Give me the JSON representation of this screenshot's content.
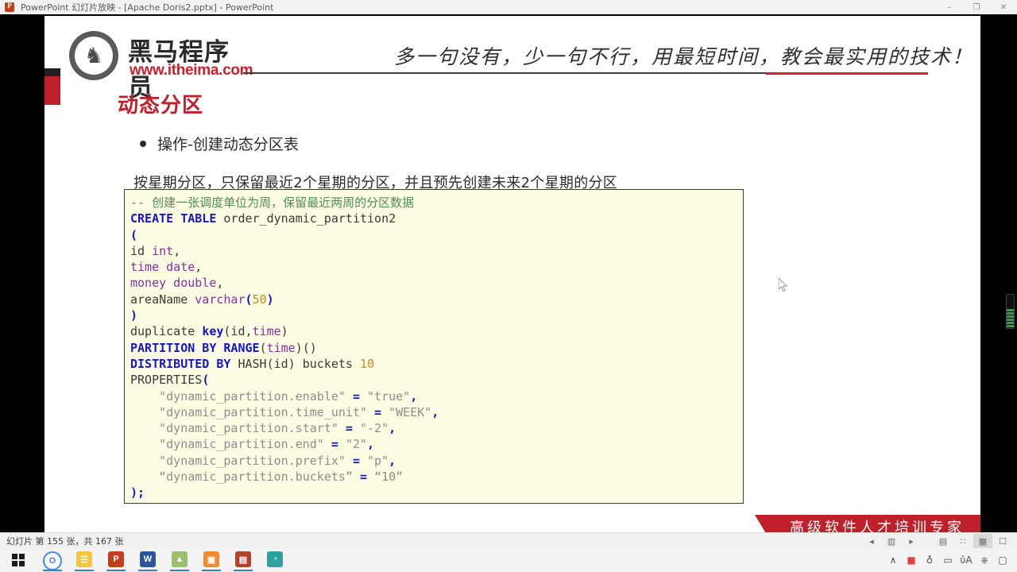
{
  "window": {
    "title": "PowerPoint 幻灯片放映 - [Apache Doris2.pptx] - PowerPoint",
    "app_icon": "powerpoint-icon",
    "minimize": "–",
    "restore": "❐",
    "close": "✕"
  },
  "slide": {
    "logo": {
      "icon": "horse-head-icon",
      "glyph": "♞",
      "name_cn": "黑马程序员",
      "url": "www.itheima.com"
    },
    "tagline": "多一句没有，少一句不行，用最短时间，教会最实用的技术！",
    "title": "动态分区",
    "bullet": "操作-创建动态分区表",
    "description": "按星期分区，只保留最近2个星期的分区，并且预先创建未来2个星期的分区",
    "ribbon": "高级软件人才培训专家",
    "accent_color": "#c0202a"
  },
  "code": {
    "language": "sql",
    "lines": [
      [
        {
          "t": "-- 创建一张调度单位为周，保留最近两周的分区数据",
          "c": "cmt"
        }
      ],
      [
        {
          "t": "CREATE TABLE",
          "c": "kw"
        },
        {
          "t": " order_dynamic_partition2",
          "c": "plain"
        }
      ],
      [
        {
          "t": "(",
          "c": "kw"
        }
      ],
      [
        {
          "t": "id ",
          "c": "plain"
        },
        {
          "t": "int",
          "c": "type"
        },
        {
          "t": ",",
          "c": "plain"
        }
      ],
      [
        {
          "t": "time date",
          "c": "type"
        },
        {
          "t": ",",
          "c": "plain"
        }
      ],
      [
        {
          "t": "money double",
          "c": "type"
        },
        {
          "t": ",",
          "c": "plain"
        }
      ],
      [
        {
          "t": "areaName ",
          "c": "plain"
        },
        {
          "t": "varchar",
          "c": "type"
        },
        {
          "t": "(",
          "c": "kw"
        },
        {
          "t": "50",
          "c": "num"
        },
        {
          "t": ")",
          "c": "kw"
        }
      ],
      [
        {
          "t": ")",
          "c": "kw"
        }
      ],
      [
        {
          "t": "duplicate ",
          "c": "plain"
        },
        {
          "t": "key",
          "c": "kw"
        },
        {
          "t": "(id,",
          "c": "plain"
        },
        {
          "t": "time",
          "c": "type"
        },
        {
          "t": ")",
          "c": "plain"
        }
      ],
      [
        {
          "t": "PARTITION BY RANGE",
          "c": "kw"
        },
        {
          "t": "(",
          "c": "plain"
        },
        {
          "t": "time",
          "c": "type"
        },
        {
          "t": ")()",
          "c": "plain"
        }
      ],
      [
        {
          "t": "DISTRIBUTED BY",
          "c": "kw"
        },
        {
          "t": " HASH(id) buckets ",
          "c": "plain"
        },
        {
          "t": "10",
          "c": "num"
        }
      ],
      [
        {
          "t": "PROPERTIES",
          "c": "plain"
        },
        {
          "t": "(",
          "c": "kw"
        }
      ],
      [
        {
          "t": "    \"dynamic_partition.enable\"",
          "c": "str"
        },
        {
          "t": " = ",
          "c": "kw"
        },
        {
          "t": "\"true\"",
          "c": "str"
        },
        {
          "t": ",",
          "c": "kw"
        }
      ],
      [
        {
          "t": "    \"dynamic_partition.time_unit\"",
          "c": "str"
        },
        {
          "t": " = ",
          "c": "kw"
        },
        {
          "t": "\"WEEK\"",
          "c": "str"
        },
        {
          "t": ",",
          "c": "kw"
        }
      ],
      [
        {
          "t": "    \"dynamic_partition.start\"",
          "c": "str"
        },
        {
          "t": " = ",
          "c": "kw"
        },
        {
          "t": "\"-2\"",
          "c": "str"
        },
        {
          "t": ",",
          "c": "kw"
        }
      ],
      [
        {
          "t": "    \"dynamic_partition.end\"",
          "c": "str"
        },
        {
          "t": " = ",
          "c": "kw"
        },
        {
          "t": "\"2\"",
          "c": "str"
        },
        {
          "t": ",",
          "c": "kw"
        }
      ],
      [
        {
          "t": "    \"dynamic_partition.prefix\"",
          "c": "str"
        },
        {
          "t": " = ",
          "c": "kw"
        },
        {
          "t": "\"p\"",
          "c": "str"
        },
        {
          "t": ",",
          "c": "kw"
        }
      ],
      [
        {
          "t": "    “dynamic_partition.buckets”",
          "c": "str"
        },
        {
          "t": " = ",
          "c": "kw"
        },
        {
          "t": "“10”",
          "c": "str"
        }
      ],
      [
        {
          "t": ");",
          "c": "kw"
        }
      ]
    ],
    "bg_color": "#fcfce3",
    "border_color": "#3b3a2c"
  },
  "statusbar": {
    "slide_counter": "幻灯片 第 155 张，共 167 张",
    "controls": [
      {
        "name": "previous-slide-icon",
        "glyph": "◂"
      },
      {
        "name": "pen-pointer-icon",
        "glyph": "▥"
      },
      {
        "name": "next-slide-icon",
        "glyph": "▸"
      }
    ],
    "views": [
      {
        "name": "normal-view-icon",
        "glyph": "▤",
        "active": false
      },
      {
        "name": "slide-sorter-icon",
        "glyph": "∷",
        "active": false
      },
      {
        "name": "reading-view-icon",
        "glyph": "▦",
        "active": true
      },
      {
        "name": "slideshow-view-icon",
        "glyph": "☐",
        "active": false
      }
    ]
  },
  "taskbar": {
    "start": {
      "name": "start-button",
      "label": "Windows"
    },
    "items": [
      {
        "name": "taskbar-chrome",
        "label": "O",
        "color": "#ffffff",
        "accent": "#4285f4",
        "running": true
      },
      {
        "name": "taskbar-file-explorer",
        "label": "☰",
        "color": "#f5c542",
        "running": true
      },
      {
        "name": "taskbar-powerpoint",
        "label": "P",
        "color": "#c43e1c",
        "running": true
      },
      {
        "name": "taskbar-word",
        "label": "W",
        "color": "#2b579a",
        "running": true
      },
      {
        "name": "taskbar-image-editor",
        "label": "▲",
        "color": "#9bbf6b",
        "running": true
      },
      {
        "name": "taskbar-vmware",
        "label": "▣",
        "color": "#f28b30",
        "running": true
      },
      {
        "name": "taskbar-notes",
        "label": "▤",
        "color": "#b0442a",
        "running": true
      },
      {
        "name": "taskbar-wps",
        "label": "◔",
        "color": "#2fa0a0",
        "running": false
      }
    ],
    "tray": [
      {
        "name": "show-hidden-icons",
        "glyph": "∧"
      },
      {
        "name": "antivirus-icon",
        "glyph": "■"
      },
      {
        "name": "microphone-icon",
        "glyph": "♁"
      },
      {
        "name": "battery-icon",
        "glyph": "▭"
      },
      {
        "name": "volume-icon",
        "glyph": "ὐA"
      },
      {
        "name": "network-icon",
        "glyph": "⎈"
      },
      {
        "name": "action-center-icon",
        "glyph": "▢"
      }
    ]
  },
  "green_meter": {
    "name": "recording-level-meter",
    "segments": 6
  }
}
